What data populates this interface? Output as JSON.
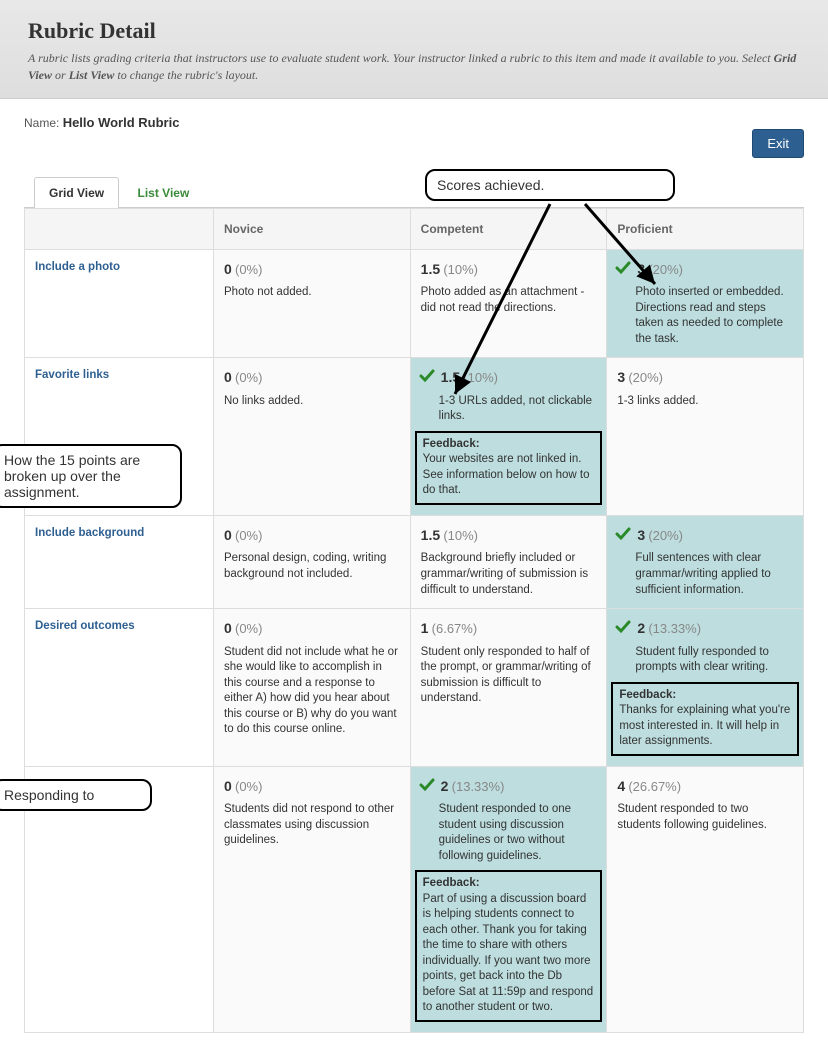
{
  "page": {
    "title": "Rubric Detail",
    "description_prefix": "A rubric lists grading criteria that instructors use to evaluate student work. Your instructor linked a rubric to this item and made it available to you. Select ",
    "bold1": "Grid View",
    "or": " or ",
    "bold2": "List View",
    "description_suffix": " to change the rubric's layout."
  },
  "name_label": "Name: ",
  "rubric_name": "Hello World Rubric",
  "exit_label": "Exit",
  "tabs": {
    "grid": "Grid View",
    "list": "List View"
  },
  "levels": {
    "novice": "Novice",
    "competent": "Competent",
    "proficient": "Proficient"
  },
  "annotations": {
    "scores": "Scores achieved.",
    "points_breakdown": "How the 15 points are broken up over the assignment.",
    "responding": "Responding to"
  },
  "rows": {
    "r1": {
      "label": "Include a photo",
      "novice": {
        "pts": "0",
        "pct": "(0%)",
        "desc": "Photo not added."
      },
      "competent": {
        "pts": "1.5",
        "pct": "(10%)",
        "desc": "Photo added as an attachment - did not read the directions."
      },
      "proficient": {
        "pts": "3",
        "pct": "(20%)",
        "desc": "Photo inserted or embedded. Directions read and steps taken as needed to complete the task.",
        "selected": true
      }
    },
    "r2": {
      "label": "Favorite links",
      "novice": {
        "pts": "0",
        "pct": "(0%)",
        "desc": "No links added."
      },
      "competent": {
        "pts": "1.5",
        "pct": "(10%)",
        "desc": "1-3 URLs added, not clickable links.",
        "selected": true,
        "feedback_label": "Feedback:",
        "feedback": "Your websites are not linked in. See information below on how to do that."
      },
      "proficient": {
        "pts": "3",
        "pct": "(20%)",
        "desc": "1-3 links added."
      }
    },
    "r3": {
      "label": "Include background",
      "novice": {
        "pts": "0",
        "pct": "(0%)",
        "desc": "Personal design, coding, writing background not included."
      },
      "competent": {
        "pts": "1.5",
        "pct": "(10%)",
        "desc": "Background briefly included or grammar/writing of submission is difficult to understand."
      },
      "proficient": {
        "pts": "3",
        "pct": "(20%)",
        "desc": "Full sentences with clear grammar/writing applied to sufficient information.",
        "selected": true
      }
    },
    "r4": {
      "label": "Desired outcomes",
      "novice": {
        "pts": "0",
        "pct": "(0%)",
        "desc": "Student did not include what he or she would like to accomplish in this course and a response to either A) how did you hear about this course or B) why do you want to do this course online."
      },
      "competent": {
        "pts": "1",
        "pct": "(6.67%)",
        "desc": "Student only responded to half of the prompt, or grammar/writing of submission is difficult to understand."
      },
      "proficient": {
        "pts": "2",
        "pct": "(13.33%)",
        "desc": "Student fully responded to prompts with clear writing.",
        "selected": true,
        "feedback_label": "Feedback:",
        "feedback": "Thanks for explaining what you're most interested in. It will help in later assignments."
      }
    },
    "r5": {
      "label": "",
      "novice": {
        "pts": "0",
        "pct": "(0%)",
        "desc": "Students did not respond to other classmates using discussion guidelines."
      },
      "competent": {
        "pts": "2",
        "pct": "(13.33%)",
        "desc": "Student responded to one student using discussion guidelines or two without following guidelines.",
        "selected": true,
        "feedback_label": "Feedback:",
        "feedback": "Part of using a discussion board is helping students connect to each other. Thank you for taking the time to share with others individually. If you want two more points, get back into the Db before Sat at 11:59p and respond to another student or two."
      },
      "proficient": {
        "pts": "4",
        "pct": "(26.67%)",
        "desc": "Student responded to two students following guidelines."
      }
    }
  }
}
